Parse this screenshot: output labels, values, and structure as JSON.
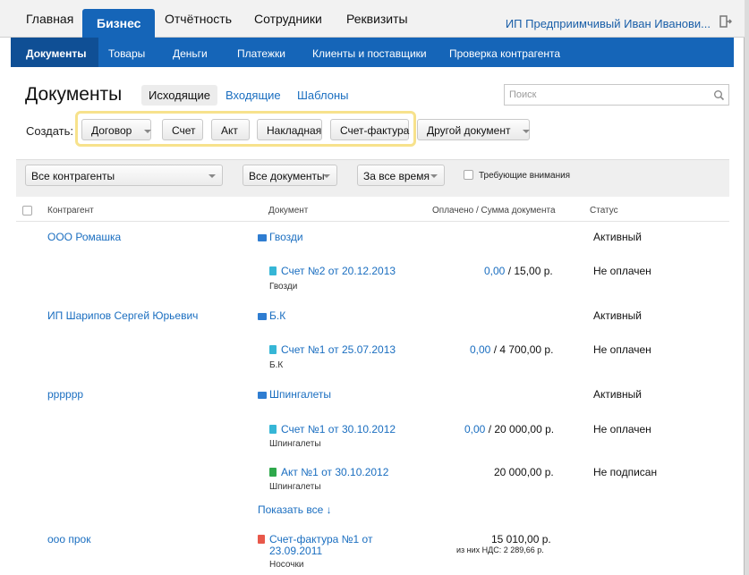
{
  "topnav": {
    "tabs": [
      "Главная",
      "Бизнес",
      "Отчётность",
      "Сотрудники",
      "Реквизиты"
    ],
    "active_tab": "Бизнес",
    "user": "ИП Предприимчивый Иван Иванови..."
  },
  "subnav": {
    "items": [
      "Документы",
      "Товары",
      "Деньги",
      "Платежки",
      "Клиенты и поставщики",
      "Проверка контрагента"
    ],
    "active": "Документы"
  },
  "page": {
    "title": "Документы",
    "tabs": [
      "Исходящие",
      "Входящие",
      "Шаблоны"
    ],
    "active_tab": "Исходящие",
    "search_placeholder": "Поиск"
  },
  "create": {
    "label": "Создать:",
    "buttons": [
      "Договор",
      "Счет",
      "Акт",
      "Накладная",
      "Счет-фактура"
    ],
    "other": "Другой документ"
  },
  "filters": {
    "contractor": "Все контрагенты",
    "documents": "Все документы",
    "period": "За все время",
    "attention": "Требующие внимания"
  },
  "table": {
    "headers": [
      "Контрагент",
      "Документ",
      "Оплачено / Сумма документа",
      "Статус"
    ],
    "rows": [
      {
        "contractor": "ООО Ромашка",
        "doc": "Гвозди",
        "sub": "",
        "paid": "",
        "total": "",
        "status": "Активный"
      },
      {
        "contractor": "",
        "doc": "Счет №2 от 20.12.2013",
        "sub": "Гвозди",
        "paid": "0,00",
        "total": " / 15,00 р.",
        "status": "Не оплачен"
      },
      {
        "contractor": "ИП Шарипов Сергей Юрьевич",
        "doc": "Б.К",
        "sub": "",
        "paid": "",
        "total": "",
        "status": "Активный"
      },
      {
        "contractor": "",
        "doc": "Счет №1 от 25.07.2013",
        "sub": "Б.К",
        "paid": "0,00",
        "total": " / 4 700,00 р.",
        "status": "Не оплачен"
      },
      {
        "contractor": "рррррр",
        "doc": "Шпингалеты",
        "sub": "",
        "paid": "",
        "total": "",
        "status": "Активный"
      },
      {
        "contractor": "",
        "doc": "Счет №1 от 30.10.2012",
        "sub": "Шпингалеты",
        "paid": "0,00",
        "total": " / 20 000,00 р.",
        "status": "Не оплачен"
      },
      {
        "contractor": "",
        "doc": "Акт №1 от 30.10.2012",
        "sub": "Шпингалеты",
        "paid": "",
        "total": "20 000,00 р.",
        "status": "Не подписан"
      },
      {
        "contractor": "ооо прок",
        "doc_line1": "Счет-фактура №1 от",
        "doc_line2": "23.09.2011",
        "sub": "Носочки",
        "total": "15 010,00 р.",
        "vat": "из них НДС: 2 289,66 р.",
        "status": ""
      }
    ],
    "show_all": "Показать все ↓"
  },
  "colors": {
    "brand_blue": "#1565b8",
    "link_blue": "#1a6ec0",
    "highlight_yellow": "#f7e28c",
    "invoice_icon": "#36b6d6",
    "act_icon": "#2ea84b",
    "factura_icon": "#e8584a",
    "folder_icon": "#2f7dd1"
  }
}
